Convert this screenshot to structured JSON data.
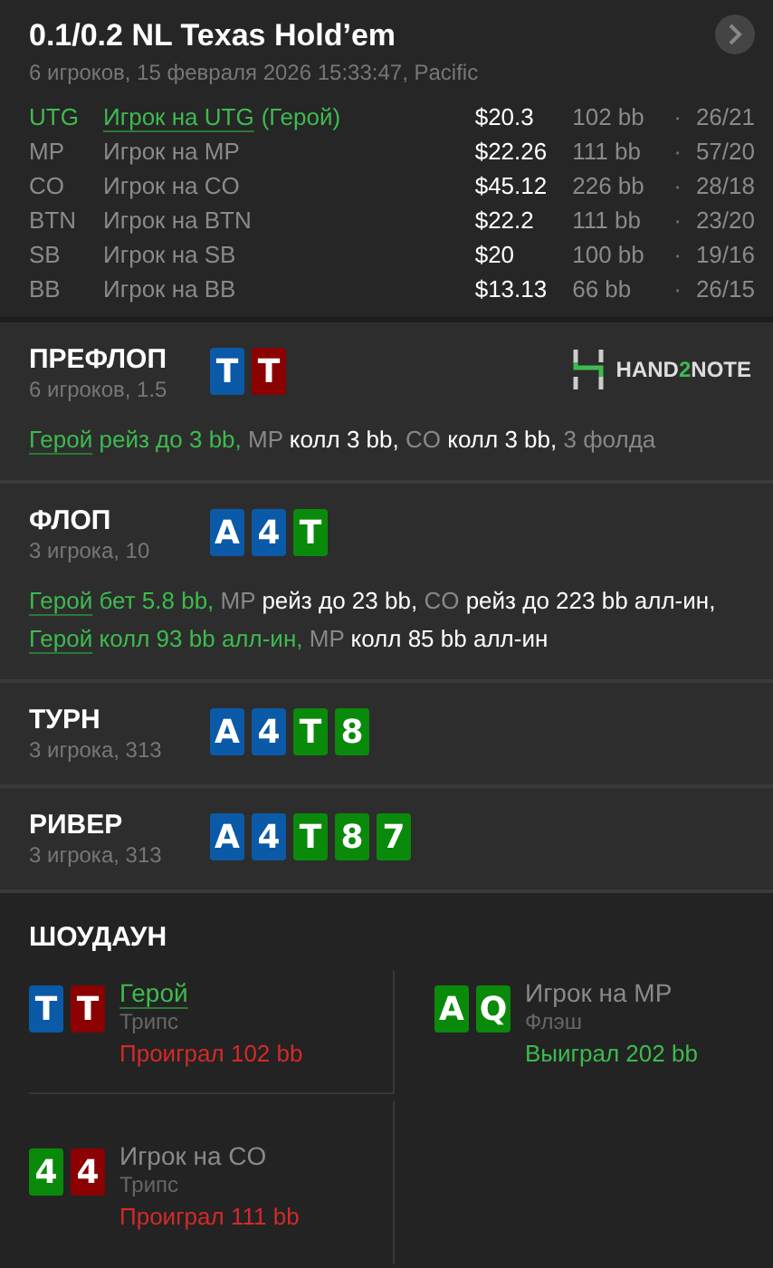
{
  "header": {
    "title": "0.1/0.2 NL Texas Hold’em",
    "subtitle": "6 игроков, 15 февраля 2026 15:33:47, Pacific"
  },
  "players": [
    {
      "position": "UTG",
      "name": "Игрок на UTG",
      "hero": true,
      "hero_tag": "(Герой)",
      "stack": "$20.3",
      "bb": "102 bb",
      "dot": "·",
      "stats": "26/21"
    },
    {
      "position": "MP",
      "name": "Игрок на MP",
      "hero": false,
      "stack": "$22.26",
      "bb": "111 bb",
      "dot": "·",
      "stats": "57/20"
    },
    {
      "position": "CO",
      "name": "Игрок на CO",
      "hero": false,
      "stack": "$45.12",
      "bb": "226 bb",
      "dot": "·",
      "stats": "28/18"
    },
    {
      "position": "BTN",
      "name": "Игрок на BTN",
      "hero": false,
      "stack": "$22.2",
      "bb": "111 bb",
      "dot": "·",
      "stats": "23/20"
    },
    {
      "position": "SB",
      "name": "Игрок на SB",
      "hero": false,
      "stack": "$20",
      "bb": "100 bb",
      "dot": "·",
      "stats": "19/16"
    },
    {
      "position": "BB",
      "name": "Игрок на BB",
      "hero": false,
      "stack": "$13.13",
      "bb": "66 bb",
      "dot": "·",
      "stats": "26/15"
    }
  ],
  "streets": [
    {
      "title": "ПРЕФЛОП",
      "info": "6 игроков, 1.5",
      "logo": {
        "before": "HAND",
        "accent": "2",
        "after": "NOTE"
      },
      "cards": [
        {
          "rank": "T",
          "color": "#0a5aa8"
        },
        {
          "rank": "T",
          "color": "#8b0000"
        }
      ],
      "actions": [
        {
          "kind": "hero",
          "text": "Герой"
        },
        {
          "kind": "hero_action",
          "text": "рейз до 3 bb,"
        },
        {
          "kind": "position",
          "text": "MP"
        },
        {
          "kind": "action",
          "text": "колл 3 bb,"
        },
        {
          "kind": "position",
          "text": "CO"
        },
        {
          "kind": "action",
          "text": "колл 3 bb,"
        },
        {
          "kind": "position",
          "text": "3 фолда"
        }
      ]
    },
    {
      "title": "ФЛОП",
      "info": "3 игрока, 10",
      "cards": [
        {
          "rank": "A",
          "color": "#0a5aa8"
        },
        {
          "rank": "4",
          "color": "#0a5aa8"
        },
        {
          "rank": "T",
          "color": "#0a8a0a"
        }
      ],
      "actions": [
        {
          "kind": "hero",
          "text": "Герой"
        },
        {
          "kind": "hero_action",
          "text": "бет 5.8 bb,"
        },
        {
          "kind": "position",
          "text": "MP"
        },
        {
          "kind": "action",
          "text": "рейз до 23 bb,"
        },
        {
          "kind": "position",
          "text": "CO"
        },
        {
          "kind": "action",
          "text": "рейз до 223 bb алл-ин,"
        },
        {
          "kind": "hero",
          "text": "Герой"
        },
        {
          "kind": "hero_action",
          "text": "колл 93 bb алл-ин,"
        },
        {
          "kind": "position",
          "text": "MP"
        },
        {
          "kind": "action",
          "text": "колл 85 bb алл-ин"
        }
      ]
    },
    {
      "title": "ТУРН",
      "info": "3 игрока, 313",
      "cards": [
        {
          "rank": "A",
          "color": "#0a5aa8"
        },
        {
          "rank": "4",
          "color": "#0a5aa8"
        },
        {
          "rank": "T",
          "color": "#0a8a0a"
        },
        {
          "rank": "8",
          "color": "#0a8a0a"
        }
      ]
    },
    {
      "title": "РИВЕР",
      "info": "3 игрока, 313",
      "cards": [
        {
          "rank": "A",
          "color": "#0a5aa8"
        },
        {
          "rank": "4",
          "color": "#0a5aa8"
        },
        {
          "rank": "T",
          "color": "#0a8a0a"
        },
        {
          "rank": "8",
          "color": "#0a8a0a"
        },
        {
          "rank": "7",
          "color": "#0a8a0a"
        }
      ]
    }
  ],
  "showdown": {
    "title": "ШОУДАУН",
    "hands": [
      {
        "name": "Герой",
        "hero": true,
        "hand": "Трипс",
        "result": "Проиграл 102 bb",
        "won": false,
        "cards": [
          {
            "rank": "T",
            "color": "#0a5aa8"
          },
          {
            "rank": "T",
            "color": "#8b0000"
          }
        ]
      },
      {
        "name": "Игрок на MP",
        "hero": false,
        "hand": "Флэш",
        "result": "Выиграл 202 bb",
        "won": true,
        "cards": [
          {
            "rank": "A",
            "color": "#0a8a0a"
          },
          {
            "rank": "Q",
            "color": "#0a8a0a"
          }
        ]
      },
      {
        "name": "Игрок на CO",
        "hero": false,
        "hand": "Трипс",
        "result": "Проиграл 111 bb",
        "won": false,
        "cards": [
          {
            "rank": "4",
            "color": "#0a8a0a"
          },
          {
            "rank": "4",
            "color": "#8b0000"
          }
        ]
      }
    ]
  }
}
